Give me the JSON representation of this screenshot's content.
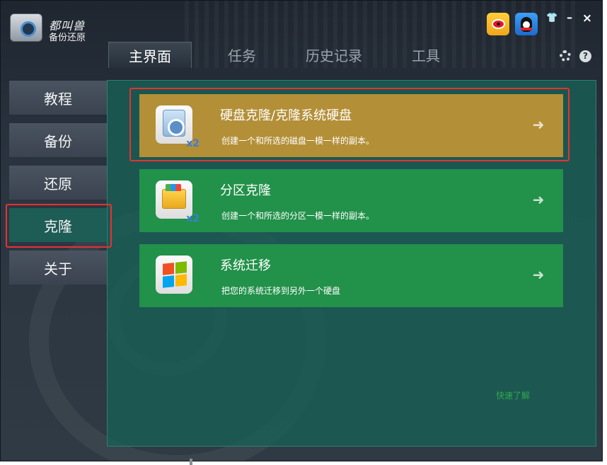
{
  "app": {
    "brand": "都叫兽",
    "subtitle": "备份还原"
  },
  "titlebar": {
    "weibo_icon": "weibo-icon",
    "qq_icon": "qq-icon",
    "skin_icon": "shirt-icon",
    "minimize_label": "–",
    "close_label": "×"
  },
  "tabs": [
    {
      "label": "主界面",
      "active": true
    },
    {
      "label": "任务",
      "active": false
    },
    {
      "label": "历史记录",
      "active": false
    },
    {
      "label": "工具",
      "active": false
    }
  ],
  "tools": {
    "settings_icon": "gear-icon",
    "help_label": "?"
  },
  "sidebar": {
    "items": [
      {
        "label": "教程",
        "active": false
      },
      {
        "label": "备份",
        "active": false
      },
      {
        "label": "还原",
        "active": false
      },
      {
        "label": "克隆",
        "active": true
      },
      {
        "label": "关于",
        "active": false
      }
    ]
  },
  "main": {
    "cards": [
      {
        "title": "硬盘克隆/克隆系统硬盘",
        "desc": "创建一个和所选的磁盘一模一样的副本。",
        "badge": "x2",
        "icon": "hard-disk-icon",
        "color": "#b38f37"
      },
      {
        "title": "分区克隆",
        "desc": "创建一个和所选的分区一模一样的副本。",
        "badge": "x2",
        "icon": "folder-icon",
        "color": "#22914a"
      },
      {
        "title": "系统迁移",
        "desc": "把您的系统迁移到另外一个硬盘",
        "badge": "",
        "icon": "windows-icon",
        "color": "#22914a"
      }
    ],
    "arrow": "➜",
    "quick_link": "快速了解"
  },
  "highlight_color": "#e53331"
}
